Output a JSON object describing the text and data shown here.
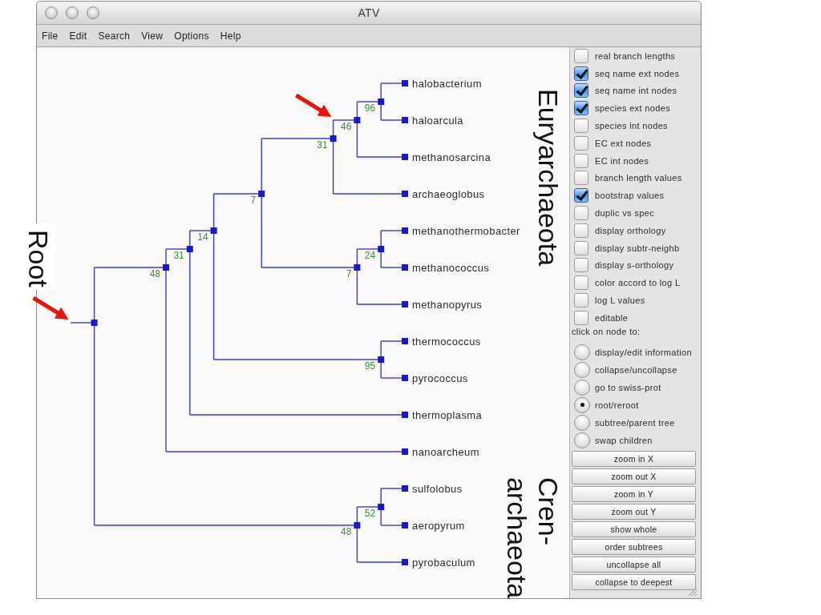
{
  "window": {
    "title": "ATV"
  },
  "menu": [
    "File",
    "Edit",
    "Search",
    "View",
    "Options",
    "Help"
  ],
  "tree": {
    "root": {
      "kind": "internal",
      "marked": true,
      "callout": "Root",
      "children": [
        {
          "kind": "internal",
          "bootstrap": "48",
          "marked": false,
          "children": [
            {
              "kind": "internal",
              "bootstrap": "31",
              "marked": false,
              "children": [
                {
                  "kind": "internal",
                  "bootstrap": "14",
                  "marked": false,
                  "children": [
                    {
                      "kind": "internal",
                      "bootstrap": "7",
                      "marked": false,
                      "children": [
                        {
                          "kind": "internal",
                          "bootstrap": "31",
                          "marked": false,
                          "children": [
                            {
                              "kind": "internal",
                              "bootstrap": "46",
                              "marked": true,
                              "children": [
                                {
                                  "kind": "internal",
                                  "bootstrap": "96",
                                  "marked": false,
                                  "children": [
                                    {
                                      "kind": "leaf",
                                      "name": "halobacterium",
                                      "marked": false
                                    },
                                    {
                                      "kind": "leaf",
                                      "name": "haloarcula",
                                      "marked": false
                                    }
                                  ]
                                },
                                {
                                  "kind": "leaf",
                                  "name": "methanosarcina",
                                  "marked": false
                                }
                              ]
                            },
                            {
                              "kind": "leaf",
                              "name": "archaeoglobus",
                              "marked": false
                            }
                          ]
                        },
                        {
                          "kind": "internal",
                          "bootstrap": "7",
                          "marked": false,
                          "children": [
                            {
                              "kind": "internal",
                              "bootstrap": "24",
                              "marked": false,
                              "children": [
                                {
                                  "kind": "leaf",
                                  "name": "methanothermobacter",
                                  "marked": false
                                },
                                {
                                  "kind": "leaf",
                                  "name": "methanococcus",
                                  "marked": false
                                }
                              ]
                            },
                            {
                              "kind": "leaf",
                              "name": "methanopyrus",
                              "marked": false
                            }
                          ]
                        }
                      ]
                    },
                    {
                      "kind": "internal",
                      "bootstrap": "95",
                      "marked": false,
                      "children": [
                        {
                          "kind": "leaf",
                          "name": "thermococcus",
                          "marked": false
                        },
                        {
                          "kind": "leaf",
                          "name": "pyrococcus",
                          "marked": false
                        }
                      ]
                    }
                  ]
                },
                {
                  "kind": "leaf",
                  "name": "thermoplasma",
                  "marked": false
                }
              ]
            },
            {
              "kind": "leaf",
              "name": "nanoarcheum",
              "marked": false
            }
          ]
        },
        {
          "kind": "internal",
          "bootstrap": "48",
          "marked": false,
          "children": [
            {
              "kind": "internal",
              "bootstrap": "52",
              "marked": false,
              "children": [
                {
                  "kind": "leaf",
                  "name": "sulfolobus",
                  "marked": false
                },
                {
                  "kind": "leaf",
                  "name": "aeropyrum",
                  "marked": false
                }
              ]
            },
            {
              "kind": "leaf",
              "name": "pyrobaculum",
              "marked": false
            }
          ]
        }
      ]
    }
  },
  "clade_labels": [
    "Euryarchaeota",
    "Cren-archaeota"
  ],
  "display_options": [
    {
      "label": "real branch lengths",
      "checked": false
    },
    {
      "label": "seq name ext nodes",
      "checked": true
    },
    {
      "label": "seq name int nodes",
      "checked": true
    },
    {
      "label": "species ext nodes",
      "checked": true
    },
    {
      "label": "species int nodes",
      "checked": false
    },
    {
      "label": "EC ext nodes",
      "checked": false
    },
    {
      "label": "EC int nodes",
      "checked": false
    },
    {
      "label": "branch length values",
      "checked": false
    },
    {
      "label": "bootstrap values",
      "checked": true
    },
    {
      "label": "duplic vs spec",
      "checked": false
    },
    {
      "label": "display orthology",
      "checked": false
    },
    {
      "label": "display subtr-neighb",
      "checked": false
    },
    {
      "label": "display s-orthology",
      "checked": false
    },
    {
      "label": "color accord to log L",
      "checked": false
    },
    {
      "label": "log L values",
      "checked": false
    },
    {
      "label": "editable",
      "checked": false
    }
  ],
  "click_prompt": "click on node to:",
  "click_actions": [
    {
      "label": "display/edit information",
      "selected": false
    },
    {
      "label": "collapse/uncollapse",
      "selected": false
    },
    {
      "label": "go to swiss-prot",
      "selected": false
    },
    {
      "label": "root/reroot",
      "selected": true
    },
    {
      "label": "subtree/parent tree",
      "selected": false
    },
    {
      "label": "swap children",
      "selected": false
    }
  ],
  "buttons": [
    "zoom in X",
    "zoom out X",
    "zoom in Y",
    "zoom out Y",
    "show whole",
    "order subtrees",
    "uncollapse all",
    "collapse to deepest"
  ]
}
